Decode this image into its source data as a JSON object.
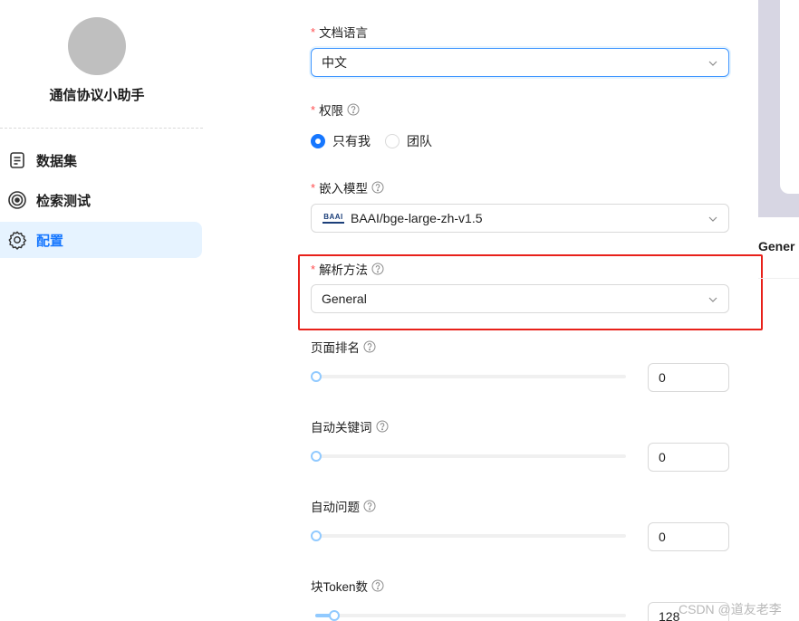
{
  "sidebar": {
    "kb_name": "通信协议小助手",
    "items": [
      {
        "label": "数据集",
        "icon": "document-icon",
        "active": false
      },
      {
        "label": "检索测试",
        "icon": "target-icon",
        "active": false
      },
      {
        "label": "配置",
        "icon": "gear-icon",
        "active": true
      }
    ]
  },
  "form": {
    "language": {
      "label": "文档语言",
      "value": "中文",
      "required": true
    },
    "permission": {
      "label": "权限",
      "required": true,
      "options": [
        "只有我",
        "团队"
      ],
      "selected": "只有我"
    },
    "embedding": {
      "label": "嵌入模型",
      "required": true,
      "value": "BAAI/bge-large-zh-v1.5",
      "logo_text": "BAAI"
    },
    "parser": {
      "label": "解析方法",
      "required": true,
      "value": "General"
    },
    "page_rank": {
      "label": "页面排名",
      "value": "0"
    },
    "auto_keywords": {
      "label": "自动关键词",
      "value": "0"
    },
    "auto_questions": {
      "label": "自动问题",
      "value": "0"
    },
    "chunk_tokens": {
      "label": "块Token数",
      "value": "128"
    }
  },
  "right_panel": {
    "label": "Gener"
  },
  "watermark": "CSDN @道友老李",
  "colors": {
    "primary": "#1677ff",
    "highlight": "#e8211a",
    "slider": "#91caff"
  }
}
